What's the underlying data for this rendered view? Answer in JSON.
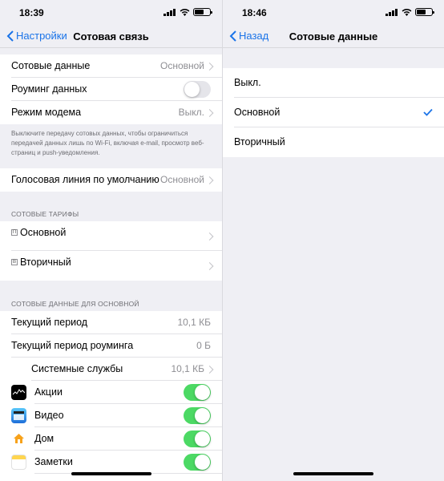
{
  "left": {
    "status": {
      "time": "18:39"
    },
    "nav": {
      "back_label": "Настройки",
      "title": "Сотовая связь"
    },
    "group1": {
      "cellular_data": {
        "label": "Сотовые данные",
        "value": "Основной"
      },
      "roaming": {
        "label": "Роуминг данных",
        "on": false
      },
      "modem": {
        "label": "Режим модема",
        "value": "Выкл."
      }
    },
    "footnote": "Выключите передачу сотовых данных, чтобы ограничиться передачей данных лишь по Wi-Fi, включая e-mail, просмотр веб-страниц и push-уведомления.",
    "voice": {
      "label": "Голосовая линия по умолчанию",
      "value": "Основной"
    },
    "plans_header": "СОТОВЫЕ ТАРИФЫ",
    "plans": [
      {
        "badge": "П",
        "label": "Основной"
      },
      {
        "badge": "В",
        "label": "Вторичный"
      }
    ],
    "usage_header": "СОТОВЫЕ ДАННЫЕ ДЛЯ ОСНОВНОЙ",
    "usage": {
      "current": {
        "label": "Текущий период",
        "value": "10,1 КБ"
      },
      "roaming": {
        "label": "Текущий период роуминга",
        "value": "0 Б"
      },
      "system": {
        "label": "Системные службы",
        "value": "10,1 КБ"
      }
    },
    "apps": [
      {
        "label": "Акции",
        "icon": "stocks-icon",
        "on": true
      },
      {
        "label": "Видео",
        "icon": "video-icon",
        "on": true
      },
      {
        "label": "Дом",
        "icon": "home-icon",
        "on": true
      },
      {
        "label": "Заметки",
        "icon": "notes-icon",
        "on": true
      }
    ]
  },
  "right": {
    "status": {
      "time": "18:46"
    },
    "nav": {
      "back_label": "Назад",
      "title": "Сотовые данные"
    },
    "options": [
      {
        "label": "Выкл.",
        "selected": false
      },
      {
        "label": "Основной",
        "selected": true
      },
      {
        "label": "Вторичный",
        "selected": false
      }
    ]
  },
  "colors": {
    "accent": "#1a73e8",
    "toggle_on": "#4cd964",
    "background": "#efeff4"
  }
}
